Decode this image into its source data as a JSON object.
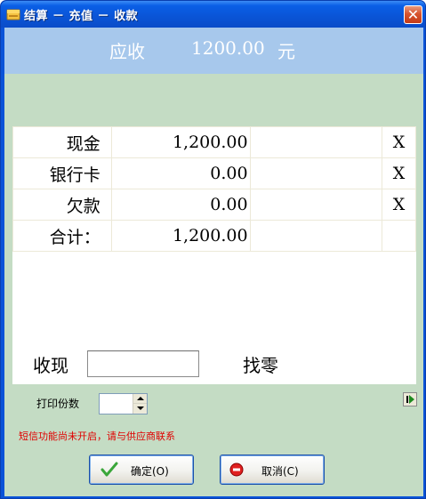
{
  "window": {
    "title": "结算 － 充值 － 收款"
  },
  "header": {
    "due_label": "应收",
    "due_amount": "1200.00",
    "due_unit": "元"
  },
  "payments": [
    {
      "method": "现金",
      "amount": "1,200.00",
      "remove": "X"
    },
    {
      "method": "银行卡",
      "amount": "0.00",
      "remove": "X"
    },
    {
      "method": "欠款",
      "amount": "0.00",
      "remove": "X"
    }
  ],
  "total": {
    "label": "合计：",
    "amount": "1,200.00"
  },
  "cash": {
    "received_label": "收现",
    "received_value": "",
    "change_label": "找零"
  },
  "print": {
    "copies_label": "打印份数",
    "copies_value": ""
  },
  "notice": "短信功能尚未开启，请与供应商联系",
  "buttons": {
    "ok_label": "确定(O)",
    "cancel_label": "取消(C)"
  },
  "icons": {
    "title": "app-icon",
    "close": "close-icon",
    "side": "next-icon",
    "ok": "check-icon",
    "cancel": "cancel-icon"
  },
  "colors": {
    "title_bar": "#0a54d6",
    "header_band": "#a7c8ec",
    "client_bg": "#c4dcc4",
    "notice_text": "#e00000"
  }
}
